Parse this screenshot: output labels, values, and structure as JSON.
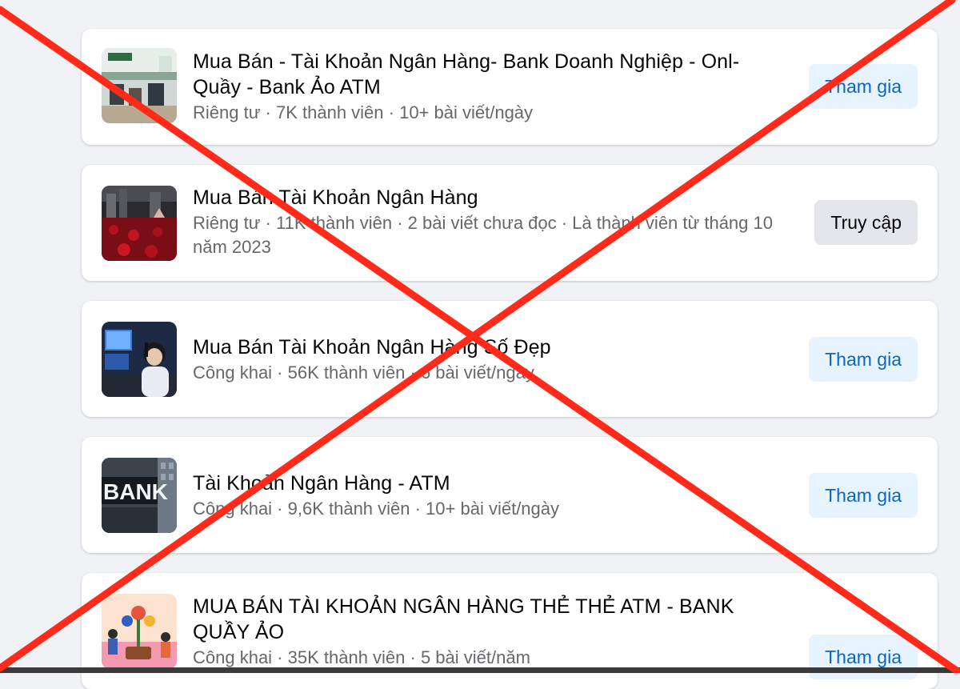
{
  "groups": [
    {
      "title": "Mua Bán - Tài Khoản Ngân Hàng- Bank Doanh Nghiệp - Onl- Quầy - Bank Ảo ATM",
      "meta": "Riêng tư · 7K thành viên · 10+ bài viết/ngày",
      "button": "Tham gia"
    },
    {
      "title": "Mua Bán Tài Khoản Ngân Hàng",
      "meta": "Riêng tư · 11K thành viên · 2 bài viết chưa đọc · Là thành viên từ tháng 10 năm 2023",
      "button": "Truy cập"
    },
    {
      "title": "Mua Bán Tài Khoản Ngân Hàng Số Đẹp",
      "meta": "Công khai · 56K thành viên · 6 bài viết/ngày",
      "button": "Tham gia"
    },
    {
      "title": "Tài Khoản Ngân Hàng - ATM",
      "meta": "Công khai · 9,6K thành viên · 10+ bài viết/ngày",
      "button": "Tham gia"
    },
    {
      "title": "MUA BÁN TÀI KHOẢN NGÂN HÀNG THẺ THẺ ATM - BANK QUẦY ẢO",
      "meta": "Công khai · 35K thành viên · 5 bài viết/năm",
      "button": "Tham gia"
    }
  ],
  "thumbnails": {
    "bank_sign_text": "BANK"
  },
  "overlay": {
    "cross_color": "#ff2a1a"
  },
  "colors": {
    "join_bg": "#e7f3ff",
    "join_text": "#0a66c2",
    "visit_bg": "#e4e6eb",
    "meta_text": "#65676b"
  }
}
